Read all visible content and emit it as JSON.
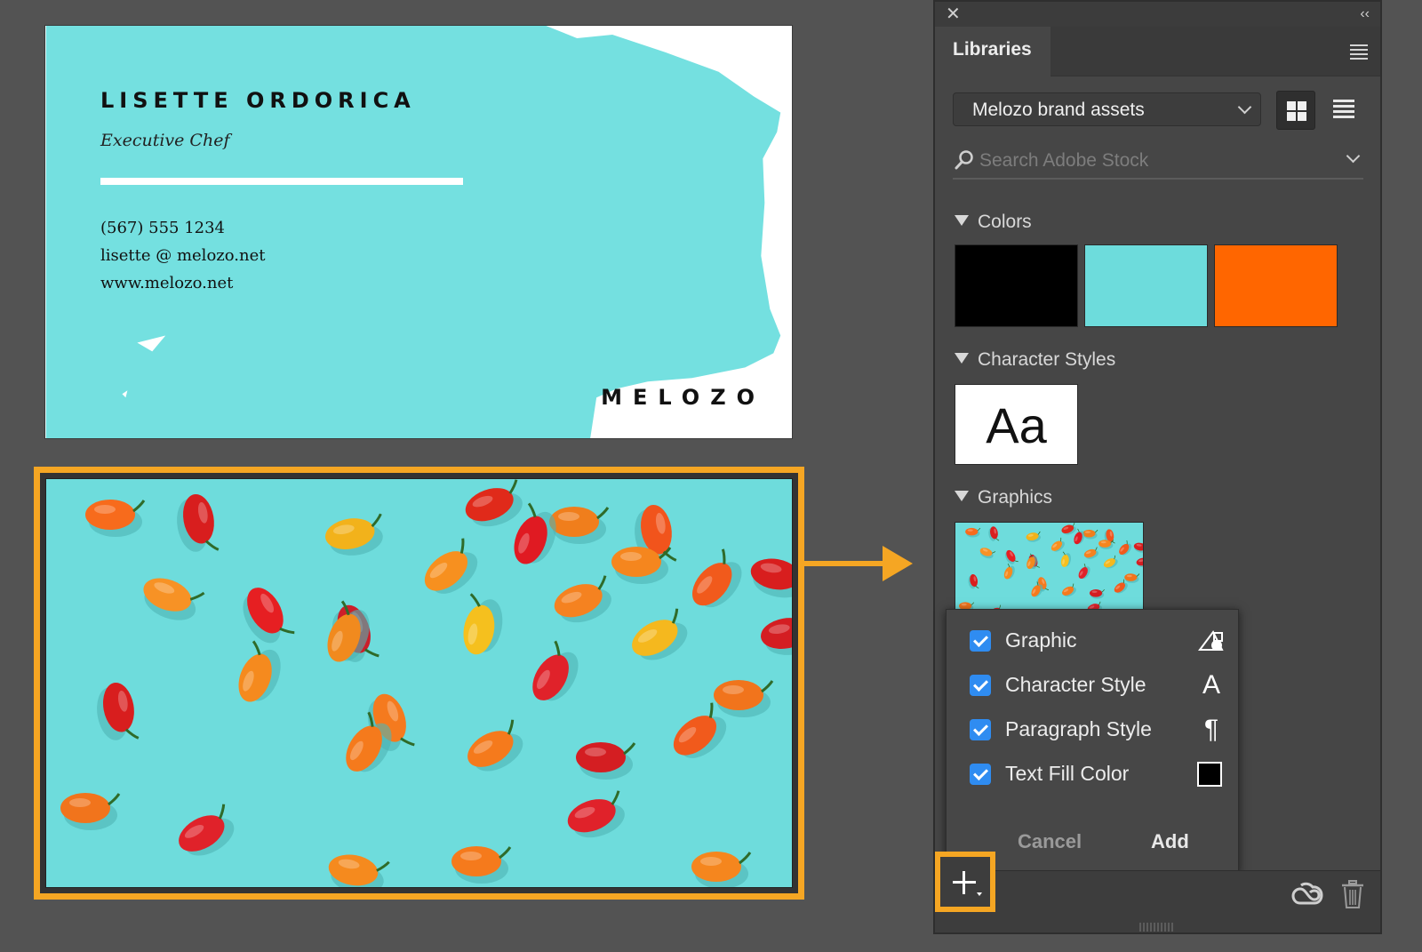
{
  "card": {
    "name": "LISETTE ORDORICA",
    "role": "Executive Chef",
    "phone": "(567) 555 1234",
    "email": "lisette @ melozo.net",
    "web": "www.melozo.net",
    "brand": "MELOZO"
  },
  "panel": {
    "tab": "Libraries",
    "library": "Melozo brand assets",
    "search_placeholder": "Search Adobe Stock",
    "sections": {
      "colors": "Colors",
      "character_styles": "Character Styles",
      "graphics": "Graphics"
    },
    "colors": [
      "#000000",
      "#6ddcdc",
      "#ff6600"
    ],
    "char_sample": "Aa",
    "popup": {
      "options": [
        {
          "label": "Graphic",
          "icon": "graphic-shape-icon",
          "checked": true
        },
        {
          "label": "Character Style",
          "icon": "character-style-icon",
          "checked": true
        },
        {
          "label": "Paragraph Style",
          "icon": "paragraph-style-icon",
          "checked": true
        },
        {
          "label": "Text Fill Color",
          "icon": "fill-color-icon",
          "checked": true
        }
      ],
      "char_icon_glyph": "A",
      "para_icon_glyph": "¶",
      "cancel": "Cancel",
      "add": "Add"
    }
  },
  "colors": {
    "accent_highlight": "#f5a623",
    "card_teal": "#74e0e0",
    "panel_bg": "#464646",
    "checkbox": "#2f8cf1"
  }
}
